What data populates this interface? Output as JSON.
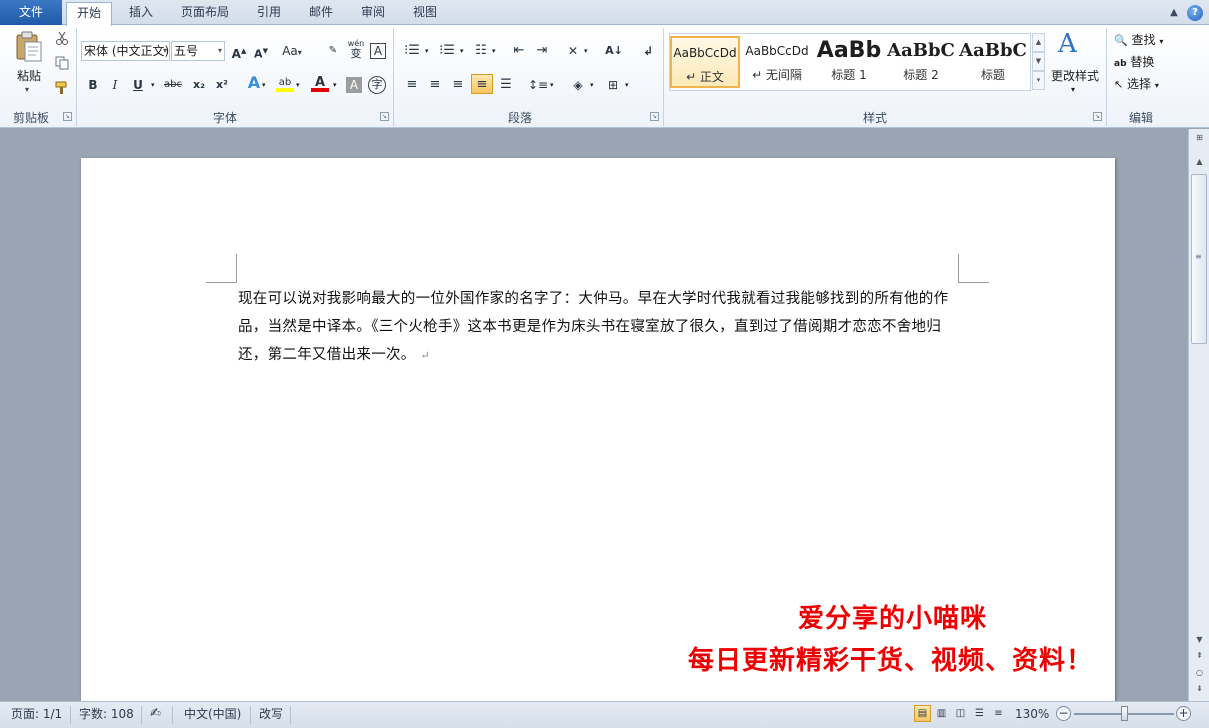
{
  "tabs": {
    "file": "文件",
    "items": [
      "开始",
      "插入",
      "页面布局",
      "引用",
      "邮件",
      "审阅",
      "视图"
    ],
    "active": "开始"
  },
  "ribbon": {
    "clipboard": {
      "label": "剪贴板",
      "paste": "粘贴"
    },
    "font": {
      "label": "字体",
      "name": "宋体 (中文正文)",
      "size": "五号",
      "grow": "A",
      "shrink": "A",
      "case": "Aa",
      "phonetic": "wén",
      "bold": "B",
      "italic": "I",
      "underline": "U",
      "strike": "abc",
      "subscript": "x₂",
      "superscript": "x²",
      "highlight": "ab",
      "fontcolor": "A",
      "shading": "A",
      "enclose": "字"
    },
    "paragraph": {
      "label": "段落"
    },
    "styles": {
      "label": "样式",
      "items": [
        {
          "preview": "AaBbCcDd",
          "name": "↵ 正文"
        },
        {
          "preview": "AaBbCcDd",
          "name": "↵ 无间隔"
        },
        {
          "preview": "AaBb",
          "name": "标题 1"
        },
        {
          "preview": "AaBbC",
          "name": "标题 2"
        },
        {
          "preview": "AaBbC",
          "name": "标题"
        }
      ],
      "change": "更改样式"
    },
    "editing": {
      "label": "编辑",
      "find": "查找",
      "replace": "替换",
      "select": "选择"
    }
  },
  "document": {
    "paragraph": "现在可以说对我影响最大的一位外国作家的名字了：大仲马。早在大学时代我就看过我能够找到的所有他的作品，当然是中译本。《三个火枪手》这本书更是作为床头书在寝室放了很久，直到过了借阅期才恋恋不舍地归还，第二年又借出来一次。",
    "para_mark": "↵"
  },
  "watermark": {
    "line1": "爱分享的小喵咪",
    "line2": "每日更新精彩干货、视频、资料！",
    "color": "#ee0000"
  },
  "status": {
    "page": "页面: 1/1",
    "words": "字数: 108",
    "language": "中文(中国)",
    "track": "改写",
    "zoom": "130%"
  },
  "colors": {
    "file_tab": "#2a66b5",
    "accent_highlight": "#f6c65f",
    "font_color_bar": "#e00000",
    "highlight_bar": "#ffff00"
  }
}
